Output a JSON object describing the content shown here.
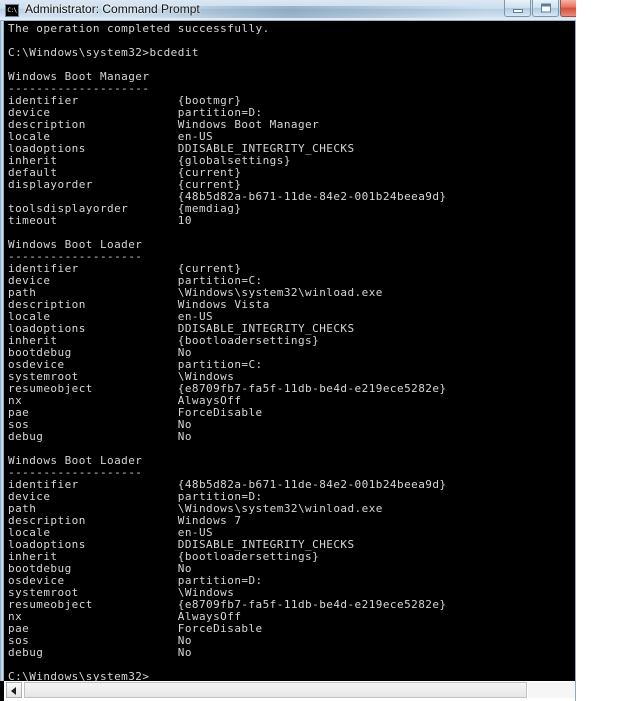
{
  "window": {
    "title": "Administrator: Command Prompt",
    "icon_name": "command-prompt-icon",
    "icon_glyph": "C:\\",
    "buttons": {
      "minimize_label": "Minimize",
      "maximize_label": "Maximize",
      "close_label": "Close"
    },
    "colors": {
      "console_background": "#000000",
      "console_foreground": "#d6d6d6",
      "titlebar_top": "#dbe7f3",
      "titlebar_bottom": "#e4eef8",
      "close_button": "#d4503c"
    }
  },
  "console": {
    "text": "The operation completed successfully.\n\nC:\\Windows\\system32>bcdedit\n\nWindows Boot Manager\n--------------------\nidentifier              {bootmgr}\ndevice                  partition=D:\ndescription             Windows Boot Manager\nlocale                  en-US\nloadoptions             DDISABLE_INTEGRITY_CHECKS\ninherit                 {globalsettings}\ndefault                 {current}\ndisplayorder            {current}\n                        {48b5d82a-b671-11de-84e2-001b24beea9d}\ntoolsdisplayorder       {memdiag}\ntimeout                 10\n\nWindows Boot Loader\n-------------------\nidentifier              {current}\ndevice                  partition=C:\npath                    \\Windows\\system32\\winload.exe\ndescription             Windows Vista\nlocale                  en-US\nloadoptions             DDISABLE_INTEGRITY_CHECKS\ninherit                 {bootloadersettings}\nbootdebug               No\nosdevice                partition=C:\nsystemroot              \\Windows\nresumeobject            {e8709fb7-fa5f-11db-be4d-e219ece5282e}\nnx                      AlwaysOff\npae                     ForceDisable\nsos                     No\ndebug                   No\n\nWindows Boot Loader\n-------------------\nidentifier              {48b5d82a-b671-11de-84e2-001b24beea9d}\ndevice                  partition=D:\npath                    \\Windows\\system32\\winload.exe\ndescription             Windows 7\nlocale                  en-US\nloadoptions             DDISABLE_INTEGRITY_CHECKS\ninherit                 {bootloadersettings}\nbootdebug               No\nosdevice                partition=D:\nsystemroot              \\Windows\nresumeobject            {e8709fb7-fa5f-11db-be4d-e219ece5282e}\nnx                      AlwaysOff\npae                     ForceDisable\nsos                     No\ndebug                   No\n\nC:\\Windows\\system32>",
    "status_line": "The operation completed successfully.",
    "command_executed": "bcdedit",
    "prompt": "C:\\Windows\\system32>",
    "sections": [
      {
        "heading": "Windows Boot Manager",
        "underline": "--------------------",
        "entries": [
          {
            "key": "identifier",
            "value": "{bootmgr}"
          },
          {
            "key": "device",
            "value": "partition=D:"
          },
          {
            "key": "description",
            "value": "Windows Boot Manager"
          },
          {
            "key": "locale",
            "value": "en-US"
          },
          {
            "key": "loadoptions",
            "value": "DDISABLE_INTEGRITY_CHECKS"
          },
          {
            "key": "inherit",
            "value": "{globalsettings}"
          },
          {
            "key": "default",
            "value": "{current}"
          },
          {
            "key": "displayorder",
            "value": "{current}"
          },
          {
            "key": "",
            "value": "{48b5d82a-b671-11de-84e2-001b24beea9d}"
          },
          {
            "key": "toolsdisplayorder",
            "value": "{memdiag}"
          },
          {
            "key": "timeout",
            "value": "10"
          }
        ]
      },
      {
        "heading": "Windows Boot Loader",
        "underline": "-------------------",
        "entries": [
          {
            "key": "identifier",
            "value": "{current}"
          },
          {
            "key": "device",
            "value": "partition=C:"
          },
          {
            "key": "path",
            "value": "\\Windows\\system32\\winload.exe"
          },
          {
            "key": "description",
            "value": "Windows Vista"
          },
          {
            "key": "locale",
            "value": "en-US"
          },
          {
            "key": "loadoptions",
            "value": "DDISABLE_INTEGRITY_CHECKS"
          },
          {
            "key": "inherit",
            "value": "{bootloadersettings}"
          },
          {
            "key": "bootdebug",
            "value": "No"
          },
          {
            "key": "osdevice",
            "value": "partition=C:"
          },
          {
            "key": "systemroot",
            "value": "\\Windows"
          },
          {
            "key": "resumeobject",
            "value": "{e8709fb7-fa5f-11db-be4d-e219ece5282e}"
          },
          {
            "key": "nx",
            "value": "AlwaysOff"
          },
          {
            "key": "pae",
            "value": "ForceDisable"
          },
          {
            "key": "sos",
            "value": "No"
          },
          {
            "key": "debug",
            "value": "No"
          }
        ]
      },
      {
        "heading": "Windows Boot Loader",
        "underline": "-------------------",
        "entries": [
          {
            "key": "identifier",
            "value": "{48b5d82a-b671-11de-84e2-001b24beea9d}"
          },
          {
            "key": "device",
            "value": "partition=D:"
          },
          {
            "key": "path",
            "value": "\\Windows\\system32\\winload.exe"
          },
          {
            "key": "description",
            "value": "Windows 7"
          },
          {
            "key": "locale",
            "value": "en-US"
          },
          {
            "key": "loadoptions",
            "value": "DDISABLE_INTEGRITY_CHECKS"
          },
          {
            "key": "inherit",
            "value": "{bootloadersettings}"
          },
          {
            "key": "bootdebug",
            "value": "No"
          },
          {
            "key": "osdevice",
            "value": "partition=D:"
          },
          {
            "key": "systemroot",
            "value": "\\Windows"
          },
          {
            "key": "resumeobject",
            "value": "{e8709fb7-fa5f-11db-be4d-e219ece5282e}"
          },
          {
            "key": "nx",
            "value": "AlwaysOff"
          },
          {
            "key": "pae",
            "value": "ForceDisable"
          },
          {
            "key": "sos",
            "value": "No"
          },
          {
            "key": "debug",
            "value": "No"
          }
        ]
      }
    ]
  },
  "scrollbar": {
    "left_arrow_name": "scroll-left-arrow",
    "orientation": "horizontal"
  }
}
